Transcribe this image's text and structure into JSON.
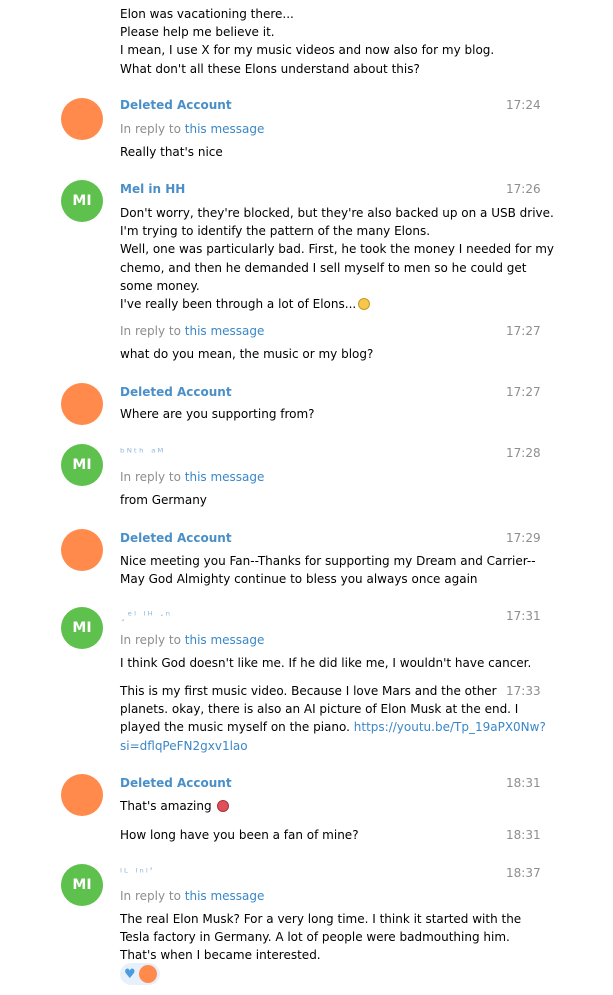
{
  "messages": [
    {
      "lines": [
        "Elon was vacationing there...",
        "Please help me believe it.",
        "I mean, I use X for my music videos and now also for my blog.",
        "What don't all these Elons understand about this?"
      ]
    },
    {
      "sender": "Deleted Account",
      "avatar": "",
      "time": "17:24",
      "reply": {
        "prefix": "In reply to",
        "link": "this message"
      },
      "lines": [
        "Really that's nice"
      ]
    },
    {
      "sender": "Mel in HH",
      "avatar": "MI",
      "time": "17:26",
      "lines": [
        "Don't worry, they're blocked, but they're also backed up on a USB drive.",
        "I'm trying to identify the pattern of the many Elons.",
        "Well, one was particularly bad. First, he took the money I needed for my",
        "chemo, and then he demanded I sell myself to men so he could get",
        "some money.",
        "I've really been through a lot of Elons..."
      ],
      "emoji": "face-screaming-in-fear-emoji"
    },
    {
      "time": "17:27",
      "reply": {
        "prefix": "In reply to",
        "link": "this message"
      },
      "lines": [
        "what do you mean, the music or my blog?"
      ]
    },
    {
      "sender": "Deleted Account",
      "avatar": "",
      "time": "17:27",
      "lines": [
        "Where are you supporting from?"
      ]
    },
    {
      "sender_blurred": "ᵇᴺᵗʰ ᵃᴹ",
      "avatar": "MI",
      "time": "17:28",
      "reply": {
        "prefix": "In reply to",
        "link": "this message"
      },
      "lines": [
        "from Germany"
      ]
    },
    {
      "sender": "Deleted Account",
      "avatar": "",
      "time": "17:29",
      "lines": [
        "Nice meeting you Fan--Thanks for supporting my Dream and Carrier--",
        "May God Almighty continue to bless you always once again"
      ]
    },
    {
      "sender_blurred": "¸ᵉˡ ᴵᴴ ·ⁿ",
      "avatar": "MI",
      "time": "17:31",
      "reply": {
        "prefix": "In reply to",
        "link": "this message"
      },
      "lines": [
        "I think God doesn't like me. If he did like me, I wouldn't have cancer."
      ]
    },
    {
      "time": "17:33",
      "lines": [
        "This is my first music video. Because I love Mars and the other",
        "planets. okay, there is also an AI picture of Elon Musk at the end. I",
        "played the music myself on the piano."
      ],
      "link_line1": "https://youtu.be/Tp_19aPX0Nw?",
      "link_line2": "si=dflqPeFN2gxv1lao"
    },
    {
      "sender": "Deleted Account",
      "avatar": "",
      "time": "18:31",
      "lines": [
        "That's amazing"
      ],
      "emoji": "smiling-face-with-heart-eyes-emoji"
    },
    {
      "time": "18:31",
      "lines": [
        "How long have you been a fan of mine?"
      ]
    },
    {
      "sender_blurred": "ᴵᴸ ᴵⁿˡʹ",
      "avatar": "MI",
      "time": "18:37",
      "reply": {
        "prefix": "In reply to",
        "link": "this message"
      },
      "lines": [
        "The real Elon Musk? For a very long time. I think it started with the",
        "Tesla factory in Germany. A lot of people were badmouthing him.",
        "That's when I became interested."
      ],
      "reaction": {
        "emoji": "heart-reaction-icon"
      }
    }
  ]
}
